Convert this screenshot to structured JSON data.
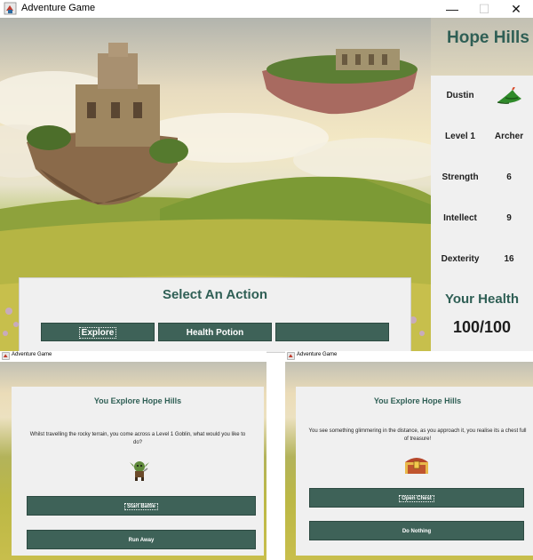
{
  "main_window": {
    "title": "Adventure Game",
    "controls": {
      "minimize": "—",
      "maximize": "☐",
      "close": "✕"
    },
    "location": "Hope Hills",
    "character": {
      "name": "Dustin",
      "icon": "archer-hat-icon",
      "level": "Level 1",
      "class": "Archer",
      "stats": [
        {
          "label": "Strength",
          "value": "6"
        },
        {
          "label": "Intellect",
          "value": "9"
        },
        {
          "label": "Dexterity",
          "value": "16"
        }
      ]
    },
    "health": {
      "label": "Your Health",
      "value": "100/100"
    },
    "actions": {
      "title": "Select An Action",
      "buttons": [
        "Explore",
        "Health Potion",
        ""
      ]
    }
  },
  "dialogs": [
    {
      "window_title": "Adventure Game",
      "title": "You Explore Hope Hills",
      "message": "Whilst travelling the rocky terrain, you come across a Level 1 Goblin, what would you like to do?",
      "icon": "goblin-icon",
      "buttons": [
        "Start Battle",
        "Run Away"
      ]
    },
    {
      "window_title": "Adventure Game",
      "title": "You Explore Hope Hills",
      "message": "You see something glimmering in the distance, as you approach it, you realise its a chest full of treasure!",
      "icon": "treasure-chest-icon",
      "buttons": [
        "Open Chest",
        "Do Nothing"
      ]
    }
  ],
  "colors": {
    "accent": "#2f5f55",
    "button": "#3e6258",
    "panel": "#f0f0f0"
  }
}
